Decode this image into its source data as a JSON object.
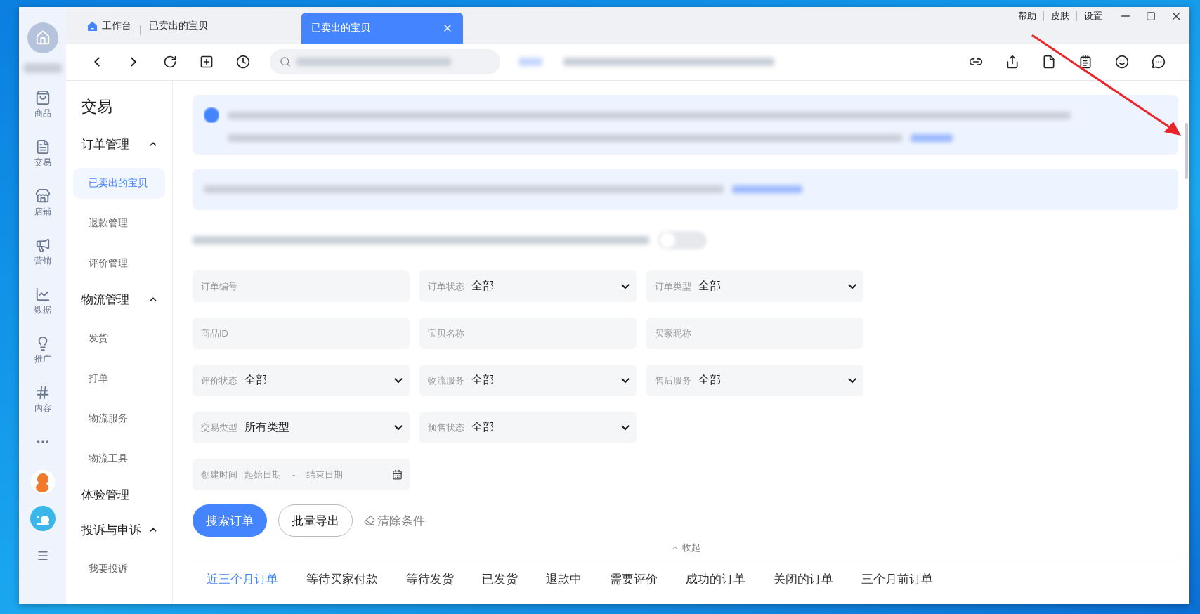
{
  "tabs": [
    {
      "label": "工作台",
      "kind": "home",
      "selected": false
    },
    {
      "label": "已卖出的宝贝",
      "kind": "page",
      "selected": false
    },
    {
      "label": "已卖出的宝贝",
      "kind": "page",
      "selected": true
    }
  ],
  "top_links": [
    "帮助",
    "皮肤",
    "设置"
  ],
  "rail": {
    "items": [
      {
        "label": "商品"
      },
      {
        "label": "交易"
      },
      {
        "label": "店铺"
      },
      {
        "label": "营销"
      },
      {
        "label": "数据"
      },
      {
        "label": "推广"
      },
      {
        "label": "内容"
      }
    ]
  },
  "notice_toggle": {
    "on": false
  },
  "nav": {
    "title": "交易",
    "groups": [
      {
        "label": "订单管理",
        "expanded": true,
        "children": [
          {
            "label": "已卖出的宝贝",
            "selected": true
          },
          {
            "label": "退款管理",
            "selected": false
          },
          {
            "label": "评价管理",
            "selected": false
          }
        ]
      },
      {
        "label": "物流管理",
        "expanded": true,
        "children": [
          {
            "label": "发货",
            "selected": false
          },
          {
            "label": "打单",
            "selected": false
          },
          {
            "label": "物流服务",
            "selected": false
          },
          {
            "label": "物流工具",
            "selected": false
          }
        ]
      },
      {
        "label": "体验管理"
      },
      {
        "label": "投诉与申诉",
        "expanded": true,
        "children": [
          {
            "label": "我要投诉",
            "selected": false
          }
        ]
      }
    ]
  },
  "filters": [
    {
      "kind": "text",
      "placeholder": "订单编号"
    },
    {
      "kind": "select",
      "label": "订单状态",
      "value": "全部"
    },
    {
      "kind": "select",
      "label": "订单类型",
      "value": "全部"
    },
    {
      "kind": "text",
      "placeholder": "商品ID"
    },
    {
      "kind": "text",
      "placeholder": "宝贝名称"
    },
    {
      "kind": "text",
      "placeholder": "买家昵称"
    },
    {
      "kind": "select",
      "label": "评价状态",
      "value": "全部"
    },
    {
      "kind": "select",
      "label": "物流服务",
      "value": "全部"
    },
    {
      "kind": "select",
      "label": "售后服务",
      "value": "全部"
    },
    {
      "kind": "select",
      "label": "交易类型",
      "value": "所有类型"
    },
    {
      "kind": "select",
      "label": "预售状态",
      "value": "全部"
    },
    {
      "kind": "date",
      "label": "创建时间",
      "start": "起始日期",
      "separator": "-",
      "end": "结束日期"
    }
  ],
  "actions": {
    "search": "搜索订单",
    "export": "批量导出",
    "clear": "清除条件"
  },
  "collapse": "收起",
  "order_tabs": [
    {
      "label": "近三个月订单",
      "selected": true
    },
    {
      "label": "等待买家付款",
      "selected": false
    },
    {
      "label": "等待发货",
      "selected": false
    },
    {
      "label": "已发货",
      "selected": false
    },
    {
      "label": "退款中",
      "selected": false
    },
    {
      "label": "需要评价",
      "selected": false
    },
    {
      "label": "成功的订单",
      "selected": false
    },
    {
      "label": "关闭的订单",
      "selected": false
    },
    {
      "label": "三个月前订单",
      "selected": false
    }
  ]
}
